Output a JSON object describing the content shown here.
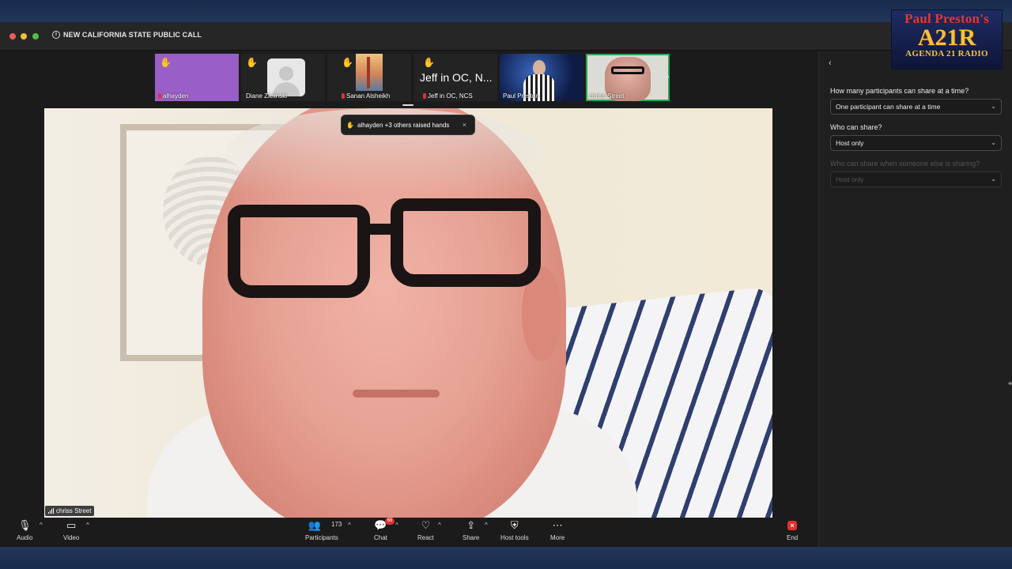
{
  "window": {
    "title": "NEW CALIFORNIA STATE PUBLIC CALL"
  },
  "logo": {
    "line1": "Paul Preston's",
    "line2": "A21R",
    "line3": "AGENDA 21 RADIO"
  },
  "participants_strip": [
    {
      "name": "alhayden",
      "raised_hand": true,
      "muted": true
    },
    {
      "name": "Diane Zielinski",
      "raised_hand": true,
      "muted": false
    },
    {
      "name": "Sanan Alsheikh",
      "raised_hand": true,
      "muted": true
    },
    {
      "name": "Jeff in OC, NCS",
      "display": "Jeff in OC, N...",
      "raised_hand": true,
      "muted": true
    },
    {
      "name": "Paul Preston",
      "raised_hand": false,
      "muted": false
    },
    {
      "name": "chriss Street",
      "raised_hand": false,
      "muted": false,
      "selected": true
    }
  ],
  "toast": {
    "text": "alhayden +3 others raised hands",
    "close": "×",
    "icon": "raised-hand-icon"
  },
  "active_speaker": {
    "name": "chriss Street"
  },
  "toolbar": {
    "audio": "Audio",
    "video": "Video",
    "participants": "Participants",
    "participants_count": "173",
    "chat": "Chat",
    "chat_badge": "66",
    "react": "React",
    "share": "Share",
    "host_tools": "Host tools",
    "more": "More",
    "end": "End"
  },
  "share_settings": {
    "q1": "How many participants can share at a time?",
    "q1_value": "One participant can share at a time",
    "q2": "Who can share?",
    "q2_value": "Host only",
    "q3": "Who can share when someone else is sharing?",
    "q3_value": "Host only"
  },
  "colors": {
    "end_red": "#e0312e",
    "selected_green": "#2ea44f",
    "badge_red": "#e0312e"
  }
}
